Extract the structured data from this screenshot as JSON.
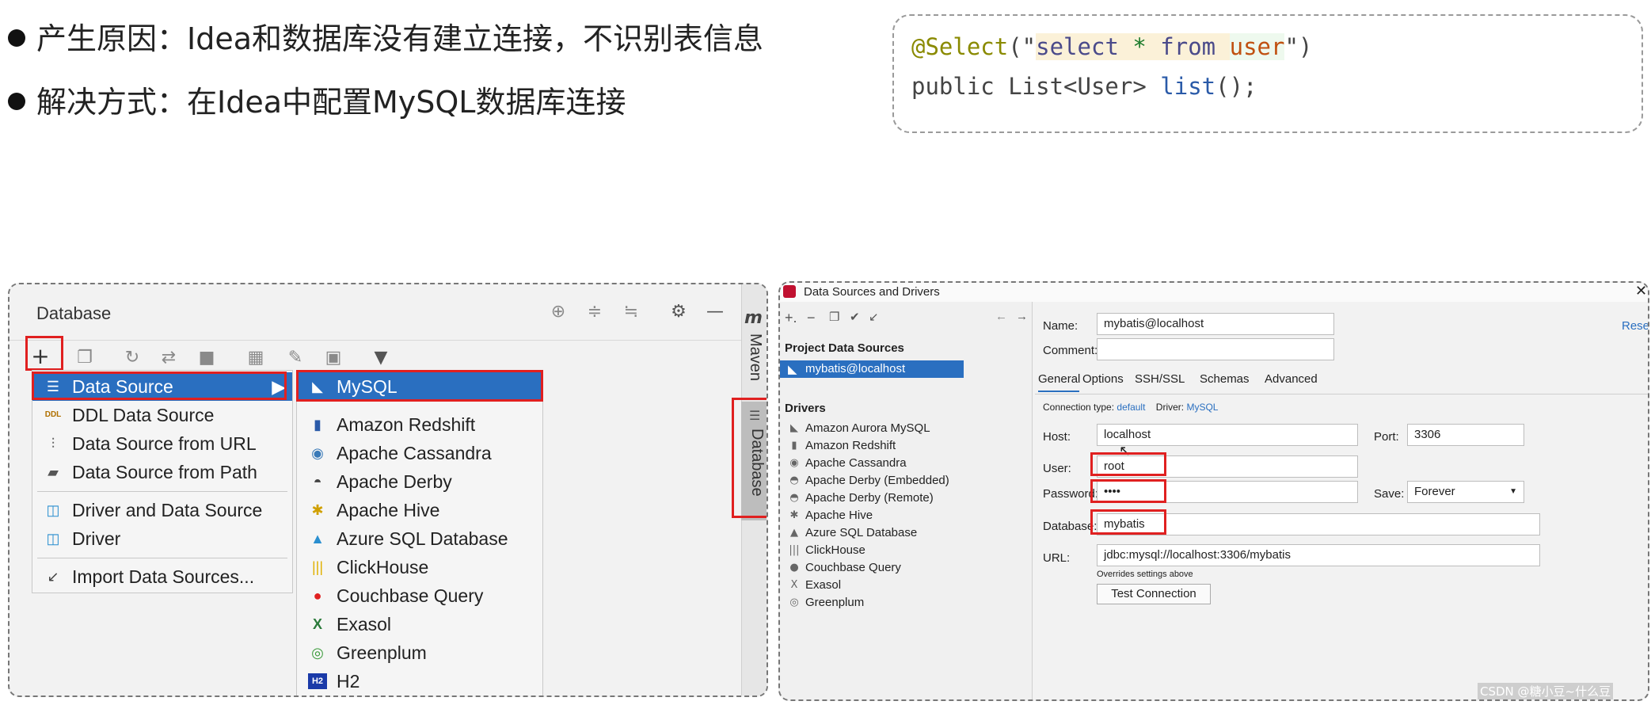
{
  "bullets": [
    "产生原因：Idea和数据库没有建立连接，不识别表信息",
    "解决方式：在Idea中配置MySQL数据库连接"
  ],
  "code": {
    "annotation": "@Select",
    "open": "(\"",
    "kw1": "select",
    "star": " * ",
    "kw2": "from",
    "space": " ",
    "table": "user",
    "close": "\")",
    "line2_a": "public ",
    "line2_b": "List<User> ",
    "line2_c": "list",
    "line2_d": "();"
  },
  "left": {
    "title": "Database",
    "side_tabs": [
      "Maven",
      "Database"
    ],
    "menu1": [
      {
        "label": "Data Source",
        "icon": "db-icon"
      },
      {
        "label": "DDL Data Source",
        "icon": "ddl-icon"
      },
      {
        "label": "Data Source from URL",
        "icon": "url-icon"
      },
      {
        "label": "Data Source from Path",
        "icon": "folder-icon"
      },
      {
        "label": "Driver and Data Source",
        "icon": "driver-icon"
      },
      {
        "label": "Driver",
        "icon": "driver-icon"
      },
      {
        "label": "Import Data Sources...",
        "icon": "import-icon"
      }
    ],
    "menu2": [
      {
        "label": "MySQL",
        "icon": "mysql-icon"
      },
      {
        "label": "Amazon Redshift",
        "icon": "redshift-icon"
      },
      {
        "label": "Apache Cassandra",
        "icon": "cassandra-icon"
      },
      {
        "label": "Apache Derby",
        "icon": "derby-icon"
      },
      {
        "label": "Apache Hive",
        "icon": "hive-icon"
      },
      {
        "label": "Azure SQL Database",
        "icon": "azure-icon"
      },
      {
        "label": "ClickHouse",
        "icon": "clickhouse-icon"
      },
      {
        "label": "Couchbase Query",
        "icon": "couchbase-icon"
      },
      {
        "label": "Exasol",
        "icon": "exasol-icon"
      },
      {
        "label": "Greenplum",
        "icon": "greenplum-icon"
      },
      {
        "label": "H2",
        "icon": "h2-icon"
      }
    ]
  },
  "right": {
    "window_title": "Data Sources and Drivers",
    "project_header": "Project Data Sources",
    "project_item": "mybatis@localhost",
    "drivers_header": "Drivers",
    "drivers": [
      "Amazon Aurora MySQL",
      "Amazon Redshift",
      "Apache Cassandra",
      "Apache Derby (Embedded)",
      "Apache Derby (Remote)",
      "Apache Hive",
      "Azure SQL Database",
      "ClickHouse",
      "Couchbase Query",
      "Exasol",
      "Greenplum"
    ],
    "name_label": "Name:",
    "name_value": "mybatis@localhost",
    "reset": "Reset",
    "comment_label": "Comment:",
    "tabs": [
      "General",
      "Options",
      "SSH/SSL",
      "Schemas",
      "Advanced"
    ],
    "conn_type_label": "Connection type:",
    "conn_type_value": "default",
    "driver_label": "Driver:",
    "driver_value": "MySQL",
    "host_label": "Host:",
    "host_value": "localhost",
    "port_label": "Port:",
    "port_value": "3306",
    "user_label": "User:",
    "user_value": "root",
    "password_label": "Password:",
    "password_value": "••••",
    "save_label": "Save:",
    "save_value": "Forever",
    "database_label": "Database:",
    "database_value": "mybatis",
    "url_label": "URL:",
    "url_value": "jdbc:mysql://localhost:3306/mybatis",
    "overrides": "Overrides settings above",
    "test_button": "Test Connection"
  },
  "watermark": "CSDN @糖小豆~什么豆"
}
